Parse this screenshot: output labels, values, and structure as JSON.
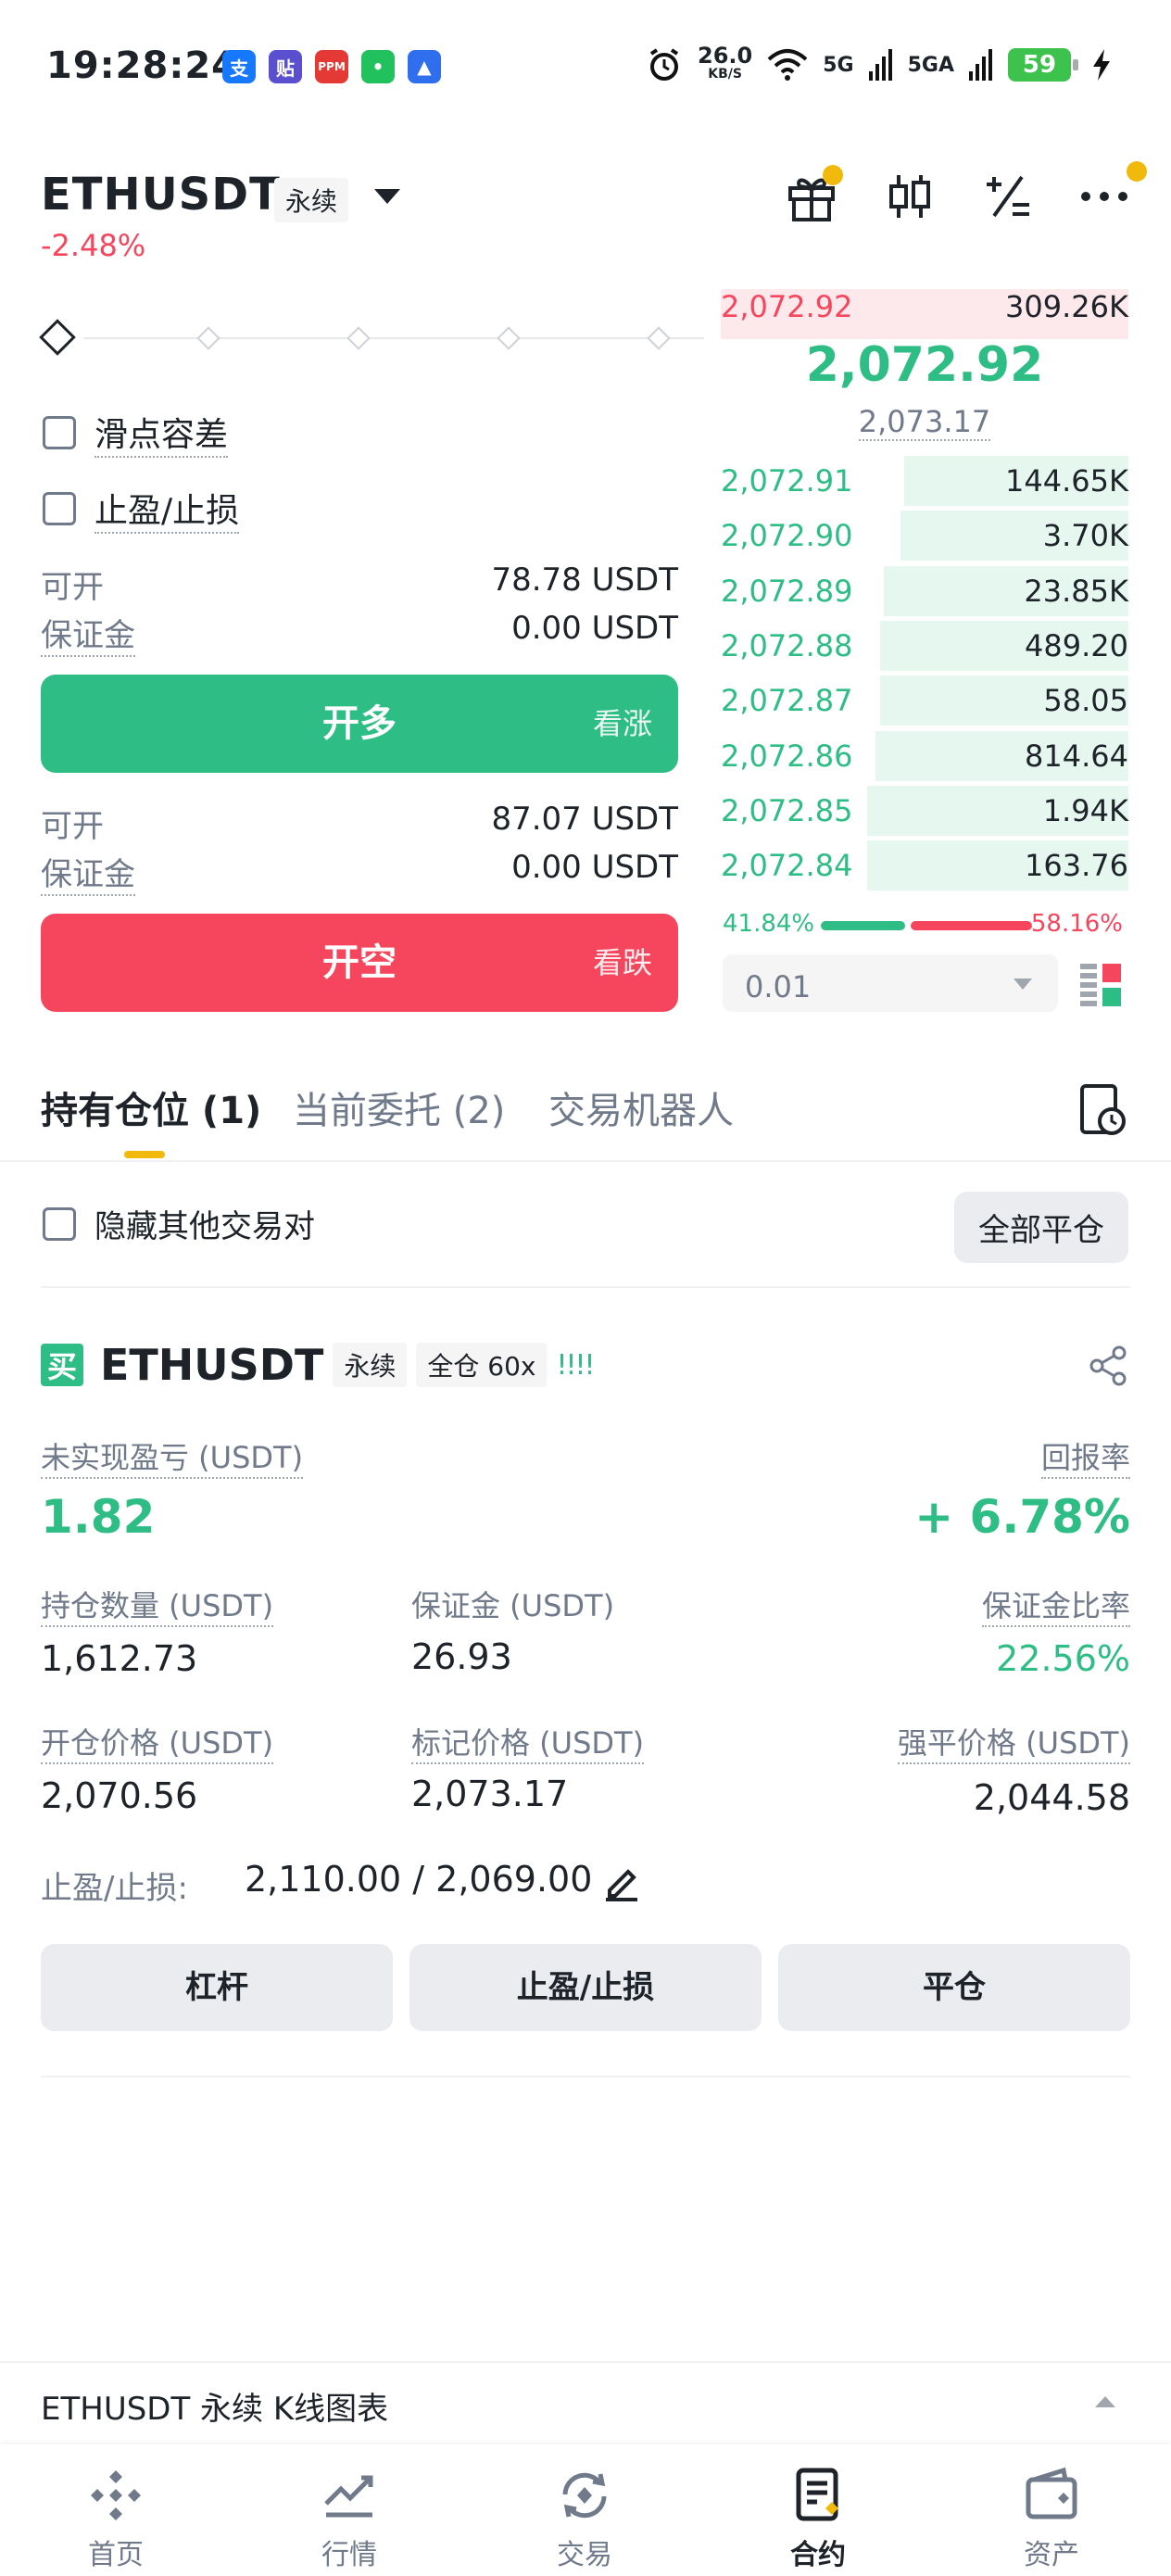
{
  "status_bar": {
    "time": "19:28:24",
    "net_speed": "26.0",
    "net_unit": "KB/S",
    "signal1": "5G",
    "signal2": "5GA",
    "battery": "59",
    "apps": [
      {
        "label": "支",
        "color": "#1677ff",
        "name": "alipay-app-icon"
      },
      {
        "label": "贴",
        "color": "#5a4fcf",
        "name": "tieba-app-icon"
      },
      {
        "label": "PPM",
        "color": "#e53935",
        "name": "ppm-app-icon"
      },
      {
        "label": "•",
        "color": "#21c25e",
        "name": "chat-app-icon"
      },
      {
        "label": "▲",
        "color": "#2f6fed",
        "name": "map-app-icon"
      }
    ]
  },
  "header": {
    "symbol": "ETHUSDT",
    "contract_type": "永续",
    "change": "-2.48%"
  },
  "trade_panel": {
    "slippage_label": "滑点容差",
    "tpsl_label": "止盈/止损",
    "long": {
      "available_label": "可开",
      "available_value": "78.78 USDT",
      "margin_label": "保证金",
      "margin_value": "0.00 USDT",
      "button_label": "开多",
      "button_sub": "看涨"
    },
    "short": {
      "available_label": "可开",
      "available_value": "87.07 USDT",
      "margin_label": "保证金",
      "margin_value": "0.00 USDT",
      "button_label": "开空",
      "button_sub": "看跌"
    }
  },
  "order_book": {
    "ask": {
      "price": "2,072.92",
      "qty": "309.26K"
    },
    "last_price": "2,072.92",
    "mark_price": "2,073.17",
    "bids": [
      {
        "price": "2,072.91",
        "qty": "144.65K",
        "depth": 0.55
      },
      {
        "price": "2,072.90",
        "qty": "3.70K",
        "depth": 0.56
      },
      {
        "price": "2,072.89",
        "qty": "23.85K",
        "depth": 0.6
      },
      {
        "price": "2,072.88",
        "qty": "489.20",
        "depth": 0.61
      },
      {
        "price": "2,072.87",
        "qty": "58.05",
        "depth": 0.61
      },
      {
        "price": "2,072.86",
        "qty": "814.64",
        "depth": 0.62
      },
      {
        "price": "2,072.85",
        "qty": "1.94K",
        "depth": 0.64
      },
      {
        "price": "2,072.84",
        "qty": "163.76",
        "depth": 0.64
      }
    ],
    "buy_ratio": "41.84%",
    "sell_ratio": "58.16%",
    "buy_ratio_value": 0.4184,
    "precision": "0.01"
  },
  "tabs": [
    {
      "label": "持有仓位 (1)",
      "active": true
    },
    {
      "label": "当前委托 (2)",
      "active": false
    },
    {
      "label": "交易机器人",
      "active": false
    }
  ],
  "positions_toolbar": {
    "hide_others_label": "隐藏其他交易对",
    "close_all_label": "全部平仓"
  },
  "position": {
    "side_badge": "买",
    "symbol": "ETHUSDT",
    "contract_type": "永续",
    "margin_mode": "全仓 60x",
    "strength_bars": "!!!!",
    "unrealized_label": "未实现盈亏 (USDT)",
    "unrealized_value": "1.82",
    "roe_label": "回报率",
    "roe_value": "+ 6.78%",
    "size_label": "持仓数量 (USDT)",
    "size_value": "1,612.73",
    "margin_label": "保证金 (USDT)",
    "margin_value": "26.93",
    "margin_ratio_label": "保证金比率",
    "margin_ratio_value": "22.56%",
    "entry_label": "开仓价格 (USDT)",
    "entry_value": "2,070.56",
    "mark_label": "标记价格 (USDT)",
    "mark_value": "2,073.17",
    "liq_label": "强平价格 (USDT)",
    "liq_value": "2,044.58",
    "tpsl_label": "止盈/止损:",
    "tpsl_value": "2,110.00 / 2,069.00",
    "buttons": [
      "杠杆",
      "止盈/止损",
      "平仓"
    ]
  },
  "kline_bar": {
    "label": "ETHUSDT 永续 K线图表"
  },
  "bottom_nav": [
    {
      "label": "首页",
      "icon": "home-icon",
      "active": false
    },
    {
      "label": "行情",
      "icon": "markets-icon",
      "active": false
    },
    {
      "label": "交易",
      "icon": "trade-icon",
      "active": false
    },
    {
      "label": "合约",
      "icon": "futures-icon",
      "active": true
    },
    {
      "label": "资产",
      "icon": "wallet-icon",
      "active": false
    }
  ],
  "colors": {
    "green": "#2ebd85",
    "red": "#f6465d",
    "yellow": "#f0b90b"
  }
}
